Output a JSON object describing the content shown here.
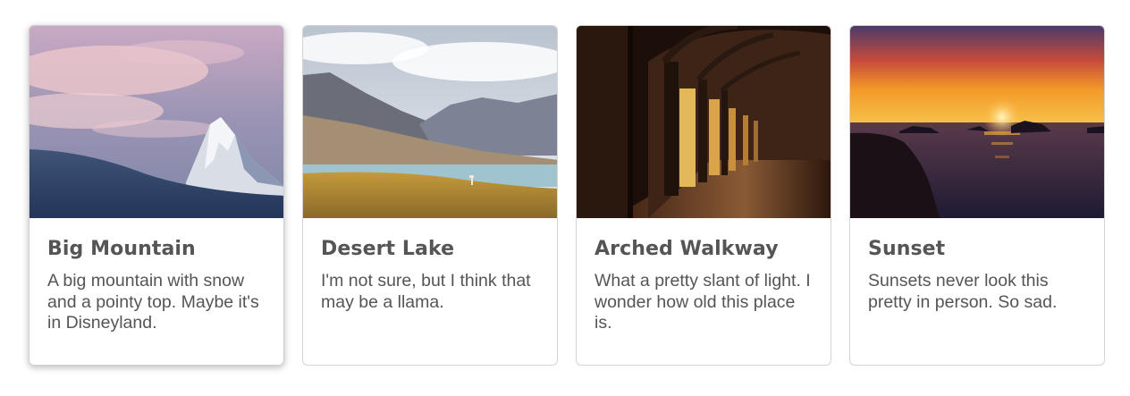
{
  "cards": [
    {
      "title": "Big Mountain",
      "text": "A big mountain with snow and a pointy top. Maybe it's in Disneyland.",
      "image_icon": "mountain-photo",
      "hovered": true
    },
    {
      "title": "Desert Lake",
      "text": "I'm not sure, but I think that may be a llama.",
      "image_icon": "desert-lake-photo",
      "hovered": false
    },
    {
      "title": "Arched Walkway",
      "text": "What a pretty slant of light. I wonder how old this place is.",
      "image_icon": "arched-walkway-photo",
      "hovered": false
    },
    {
      "title": "Sunset",
      "text": "Sunsets never look this pretty in person. So sad.",
      "image_icon": "sunset-photo",
      "hovered": false
    }
  ],
  "colors": {
    "text": "#555555",
    "border": "#d4d4d4",
    "background": "#ffffff"
  }
}
